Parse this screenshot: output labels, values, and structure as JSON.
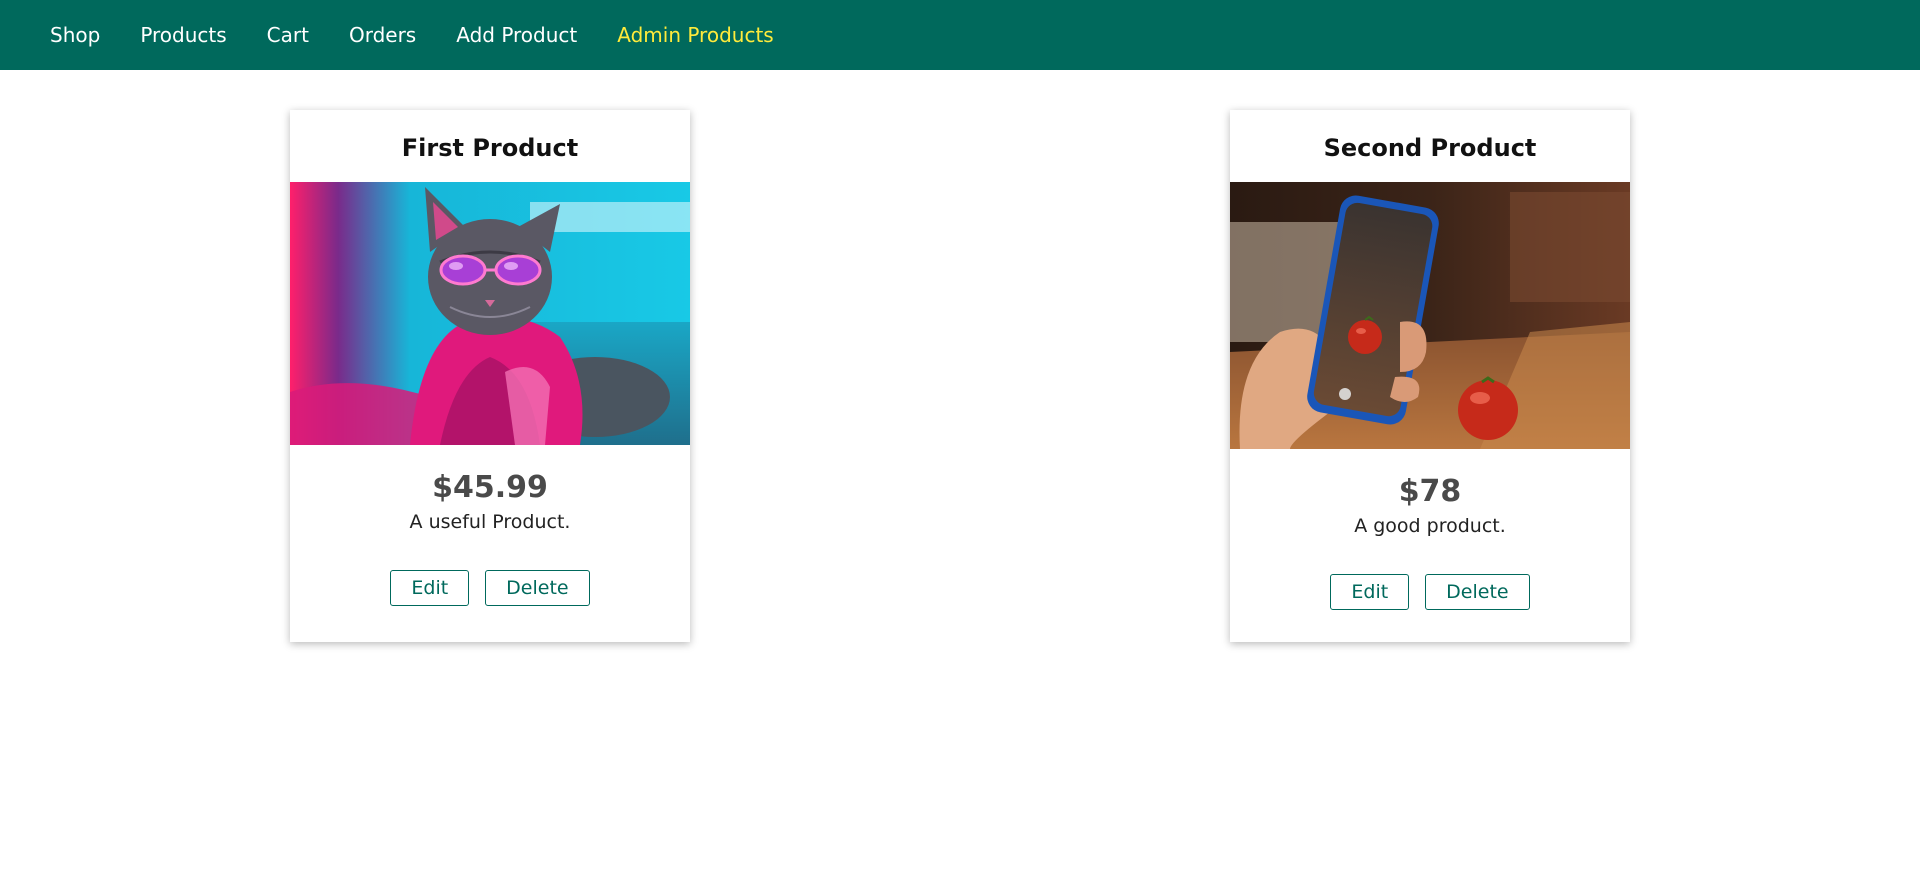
{
  "nav": {
    "items": [
      {
        "label": "Shop",
        "active": false
      },
      {
        "label": "Products",
        "active": false
      },
      {
        "label": "Cart",
        "active": false
      },
      {
        "label": "Orders",
        "active": false
      },
      {
        "label": "Add Product",
        "active": false
      },
      {
        "label": "Admin Products",
        "active": true
      }
    ],
    "bg_color": "#00695c",
    "active_color": "#ffeb3b"
  },
  "products": [
    {
      "title": "First Product",
      "image": "cat-with-sunglasses-neon-photo",
      "price": "$45.99",
      "description": "A useful Product.",
      "edit_label": "Edit",
      "delete_label": "Delete"
    },
    {
      "title": "Second Product",
      "image": "hand-holding-phone-photographing-tomato",
      "price": "$78",
      "description": "A good product.",
      "edit_label": "Edit",
      "delete_label": "Delete"
    }
  ],
  "accent_color": "#00695c"
}
